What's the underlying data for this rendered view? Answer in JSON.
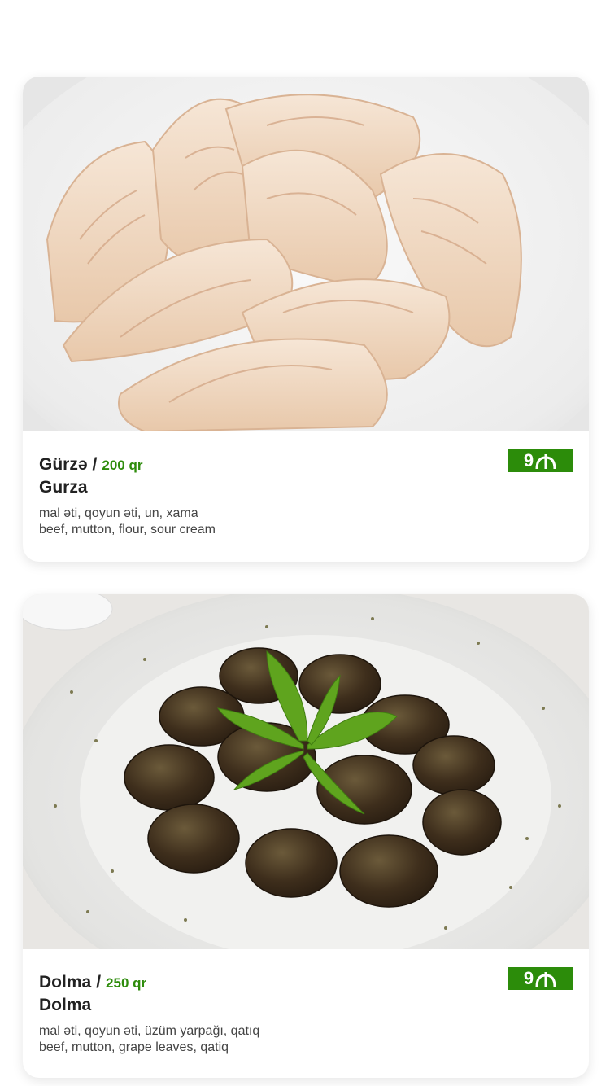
{
  "menu": {
    "items": [
      {
        "name_az": "Gürzə",
        "separator": "/",
        "weight": "200 qr",
        "name_en": "Gurza",
        "ingredients_az": "mal əti, qoyun əti, un, xama",
        "ingredients_en": "beef, mutton, flour, sour cream",
        "price": "9",
        "currency_icon": "manat-icon",
        "image_icon": "dumplings-photo"
      },
      {
        "name_az": "Dolma",
        "separator": "/",
        "weight": "250 qr",
        "name_en": "Dolma",
        "ingredients_az": "mal əti, qoyun əti, üzüm yarpağı, qatıq",
        "ingredients_en": "beef, mutton, grape leaves, qatiq",
        "price": "9",
        "currency_icon": "manat-icon",
        "image_icon": "dolma-photo"
      }
    ]
  },
  "colors": {
    "accent_green": "#2c8c0a",
    "text_dark": "#222222"
  }
}
